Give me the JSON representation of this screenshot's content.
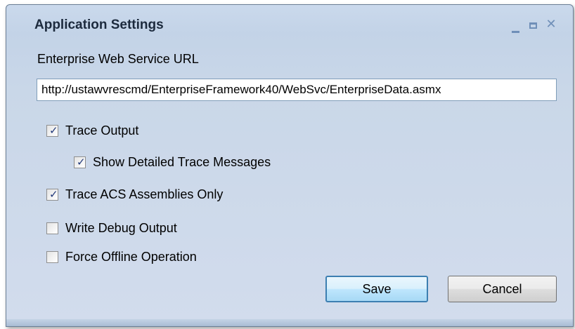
{
  "window": {
    "title": "Application Settings",
    "minimize_icon": "minimize-icon",
    "maximize_icon": "maximize-icon",
    "close_symbol": "✕",
    "close_icon": "close-icon"
  },
  "url_field": {
    "label": "Enterprise Web Service URL",
    "value": "http://ustawvrescmd/EnterpriseFramework40/WebSvc/EnterpriseData.asmx"
  },
  "options": {
    "trace_output": {
      "label": "Trace Output",
      "checked": true
    },
    "show_detailed_trace": {
      "label": "Show Detailed Trace Messages",
      "checked": true
    },
    "trace_acs_only": {
      "label": "Trace ACS Assemblies Only",
      "checked": true
    },
    "write_debug": {
      "label": "Write Debug Output",
      "checked": false
    },
    "force_offline": {
      "label": "Force Offline Operation",
      "checked": false
    }
  },
  "check_glyph": "✓",
  "buttons": {
    "save_label": "Save",
    "cancel_label": "Cancel"
  },
  "colors": {
    "accent": "#6f8fb8",
    "default_button_border": "#3c7fb1",
    "window_background": "#c9d7e8"
  }
}
